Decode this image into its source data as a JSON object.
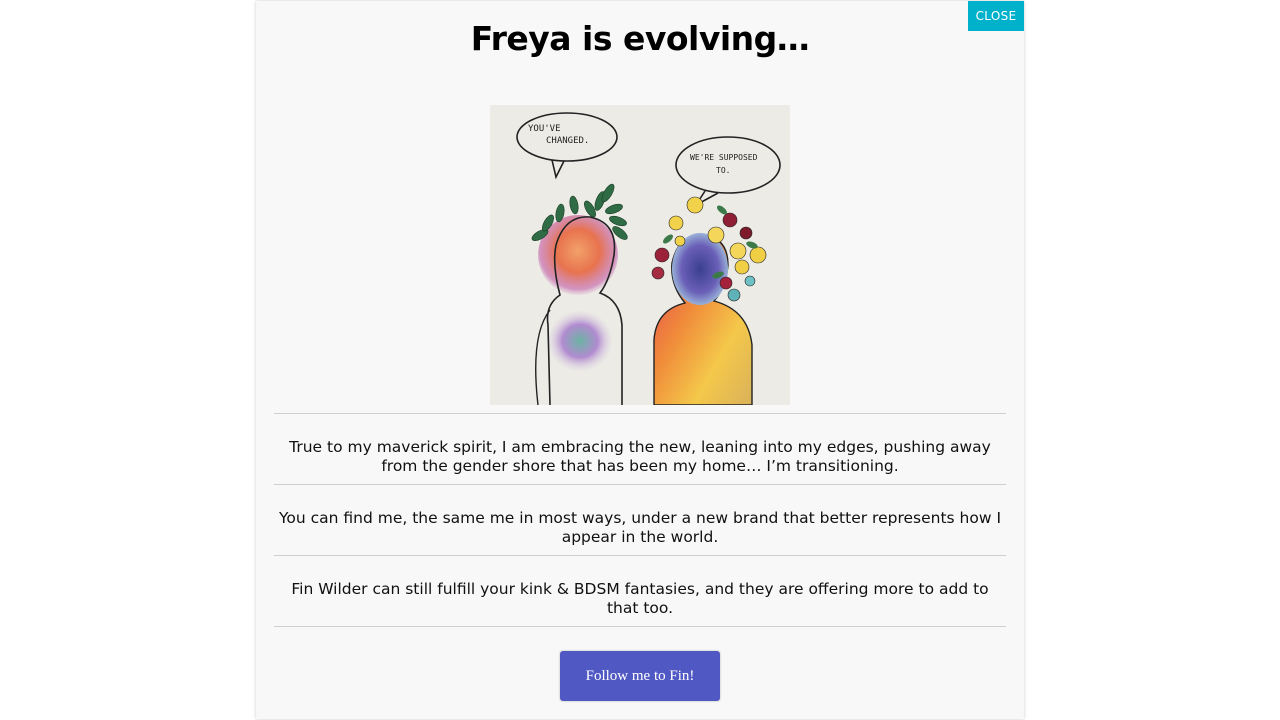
{
  "modal": {
    "close_label": "CLOSE",
    "title": "Freya is evolving…",
    "artwork": {
      "bubble_left": "YOU'VE CHANGED.",
      "bubble_left_line1": "YOU'VE",
      "bubble_left_line2": "CHANGED.",
      "bubble_right_line1": "WE'RE SUPPOSED",
      "bubble_right_line2": "TO."
    },
    "paragraphs": [
      "True to my maverick spirit, I am embracing the new, leaning into my edges, pushing away from the gender shore that has been my home… I’m transitioning.",
      "You can find me, the same me in most ways, under a new brand that better represents how I appear in the world.",
      "Fin Wilder can still fulfill your kink & BDSM fantasies, and they are offering more to add to that too."
    ],
    "cta_label": "Follow me to Fin!"
  },
  "colors": {
    "close_bg": "#00b1cc",
    "cta_bg": "#5058c3",
    "modal_bg": "#f8f8f8"
  }
}
